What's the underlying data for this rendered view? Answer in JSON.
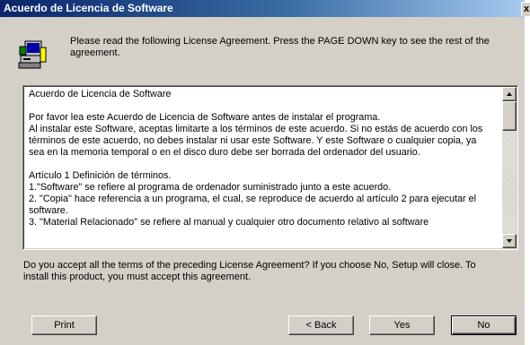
{
  "window": {
    "title": "Acuerdo de Licencia de Software",
    "close_glyph": "x"
  },
  "header": {
    "icon": "setup-computer-icon",
    "intro": "Please read the following License Agreement. Press the PAGE DOWN key to see the rest of the\nagreement."
  },
  "license": {
    "lines": [
      "Acuerdo de Licencia de Software",
      "",
      "Por favor lea este Acuerdo de Licencia de Software antes de instalar el programa.",
      "Al instalar este Software, aceptas limitarte a los términos de este acuerdo. Si no estás de acuerdo con los",
      "términos de este acuerdo, no debes instalar ni usar este Software. Y este Software o cualquier copia, ya",
      "sea en la memoria temporal o en el disco duro debe ser borrada del ordenador del usuario.",
      "",
      "Artículo 1 Definición de términos.",
      "1.\"Software\" se refiere al programa de ordenador suministrado junto a este acuerdo.",
      "2. \"Copia\" hace referencia a un programa, el cual, se reproduce de acuerdo al artículo 2 para ejecutar el",
      "software.",
      "3. \"Material Relacionado\" se refiere al manual y cualquier otro documento relativo al software"
    ]
  },
  "question": "Do you accept all the terms of the preceding License Agreement? If you choose No, Setup will close. To\ninstall this product, you must accept this agreement.",
  "buttons": {
    "print": "Print",
    "back": "< Back",
    "yes": "Yes",
    "no": "No"
  }
}
